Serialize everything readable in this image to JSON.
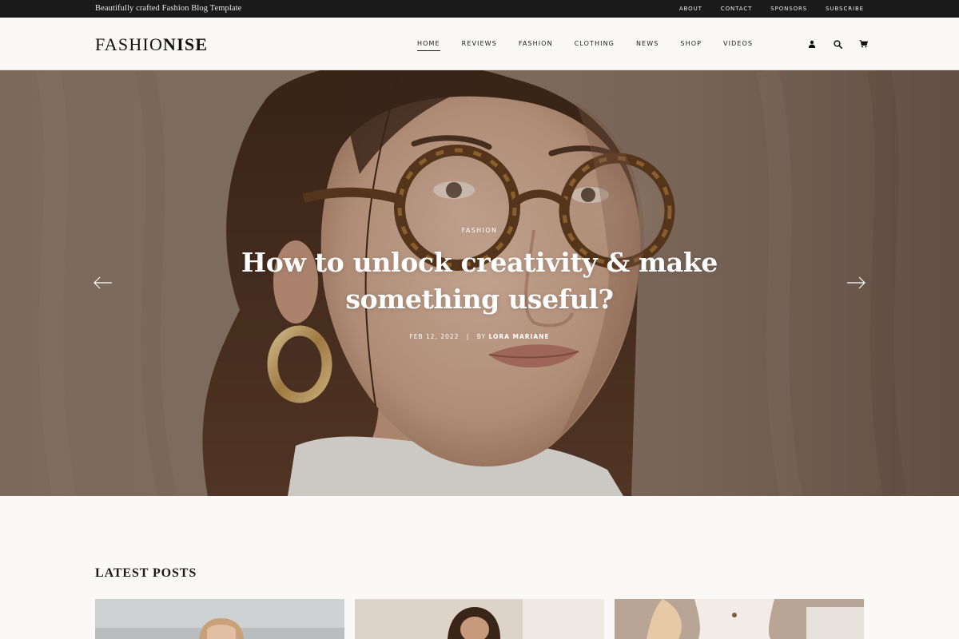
{
  "topbar": {
    "tagline": "Beautifully crafted Fashion Blog Template",
    "links": [
      "ABOUT",
      "CONTACT",
      "SPONSORS",
      "SUBSCRIBE"
    ]
  },
  "header": {
    "logo_light": "FASHIO",
    "logo_bold": "NISE",
    "nav": [
      "HOME",
      "REVIEWS",
      "FASHION",
      "CLOTHING",
      "NEWS",
      "SHOP",
      "VIDEOS"
    ],
    "active_nav": "HOME",
    "icons": [
      "user-icon",
      "search-icon",
      "cart-icon"
    ]
  },
  "hero": {
    "category": "FASHION",
    "title": "How to unlock creativity & make something useful?",
    "date": "FEB 12, 2022",
    "separator": "|",
    "by": "BY",
    "author": "LORA MARIANE",
    "prev_icon": "arrow-left-icon",
    "next_icon": "arrow-right-icon"
  },
  "latest": {
    "title": "LATEST POSTS"
  },
  "colors": {
    "topbar_bg": "#1a1a1a",
    "page_bg": "#fbf9f7",
    "hero_text": "#ffffff"
  }
}
